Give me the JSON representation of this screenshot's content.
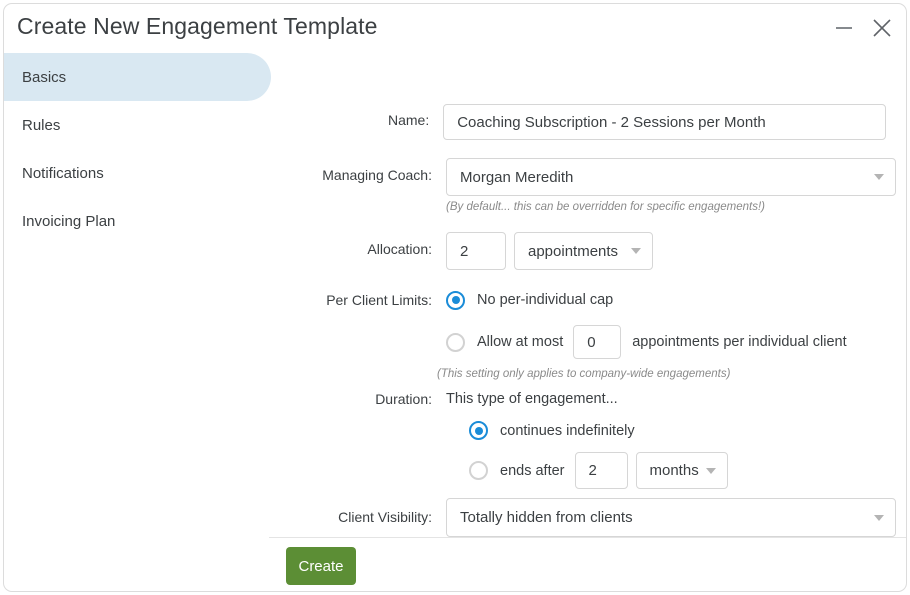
{
  "window": {
    "title": "Create New Engagement Template",
    "minimize_icon": "minimize-icon",
    "close_icon": "close-icon"
  },
  "sidebar": {
    "items": [
      {
        "label": "Basics",
        "active": true
      },
      {
        "label": "Rules",
        "active": false
      },
      {
        "label": "Notifications",
        "active": false
      },
      {
        "label": "Invoicing Plan",
        "active": false
      }
    ]
  },
  "form": {
    "name": {
      "label": "Name:",
      "value": "Coaching Subscription - 2 Sessions per Month",
      "placeholder": ""
    },
    "managing_coach": {
      "label": "Managing Coach:",
      "value": "Morgan Meredith",
      "hint": "(By default... this can be overridden for specific engagements!)"
    },
    "allocation": {
      "label": "Allocation:",
      "amount": "2",
      "unit": "appointments"
    },
    "per_client_limits": {
      "label": "Per Client Limits:",
      "option_none_label": "No per-individual cap",
      "option_none_selected": true,
      "option_cap_prefix": "Allow at most",
      "option_cap_value": "0",
      "option_cap_suffix": "appointments per individual client",
      "option_cap_selected": false,
      "hint": "(This setting only applies to company-wide engagements)"
    },
    "duration": {
      "label": "Duration:",
      "intro": "This type of engagement...",
      "option_indefinite_label": "continues indefinitely",
      "option_indefinite_selected": true,
      "option_ends_prefix": "ends after",
      "option_ends_value": "2",
      "option_ends_unit": "months",
      "option_ends_selected": false
    },
    "client_visibility": {
      "label": "Client Visibility:",
      "value": "Totally hidden from clients"
    }
  },
  "footer": {
    "create_label": "Create"
  },
  "colors": {
    "accent_blue": "#1a8cd8",
    "sidebar_active": "#d9e8f2",
    "create_green": "#5c8e35"
  }
}
